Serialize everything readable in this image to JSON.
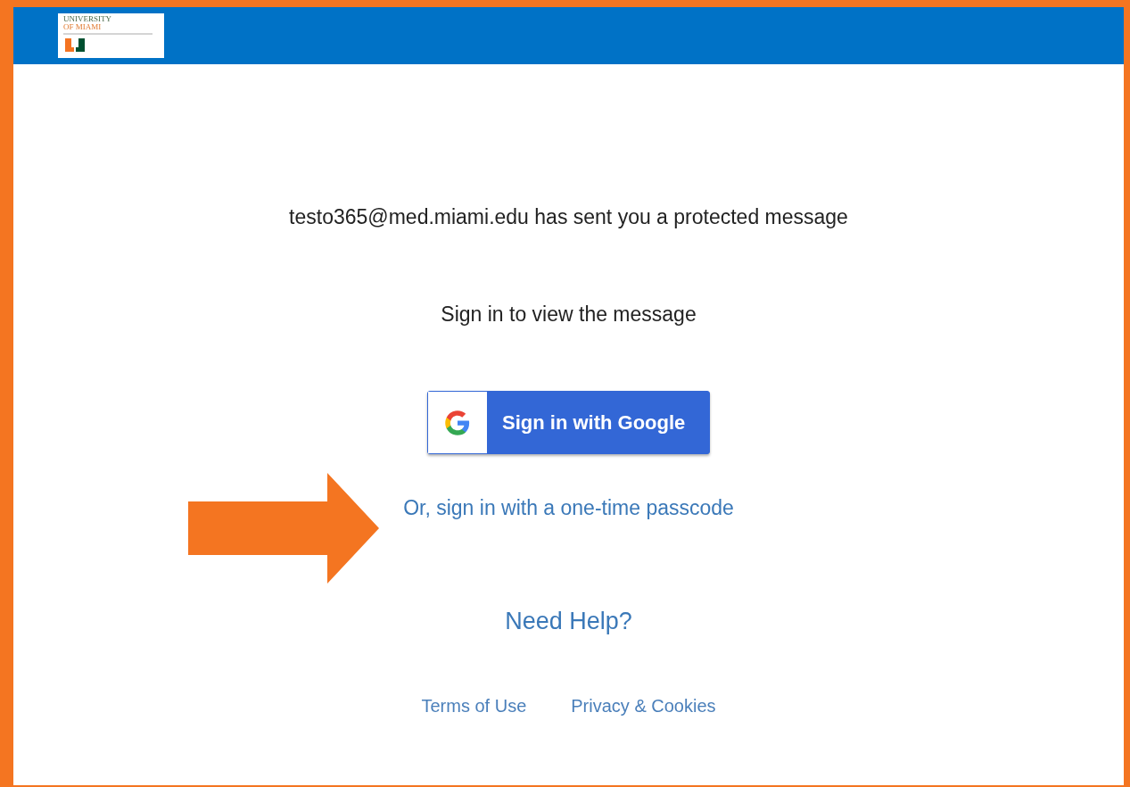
{
  "header": {
    "logo": {
      "line_1": "UNIVERSITY",
      "line_2": "OF MIAMI"
    }
  },
  "message": "testo365@med.miami.edu has sent you a protected message",
  "instruction": "Sign in to view the message",
  "google_button": {
    "label": "Sign in with Google"
  },
  "passcode_link": "Or, sign in with a one-time passcode",
  "help_link": "Need Help?",
  "footer_links": [
    "Terms of Use",
    "Privacy & Cookies"
  ]
}
